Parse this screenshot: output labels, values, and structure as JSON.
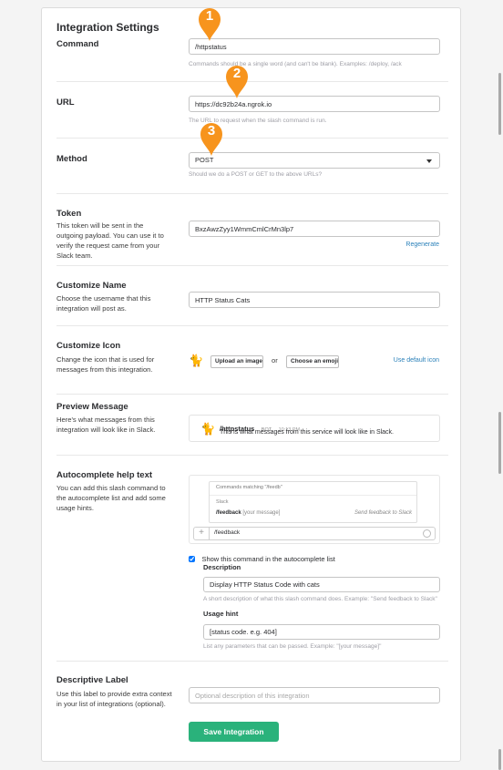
{
  "page": {
    "heading": "Integration Settings",
    "save_label": "Save Integration"
  },
  "markers": [
    "1",
    "2",
    "3"
  ],
  "command": {
    "label": "Command",
    "value": "/httpstatus",
    "hint": "Commands should be a single word (and can't be blank). Examples: /deploy, /ack"
  },
  "url": {
    "label": "URL",
    "value": "https://dc92b24a.ngrok.io",
    "hint": "The URL to request when the slash command is run."
  },
  "method": {
    "label": "Method",
    "value": "POST",
    "hint": "Should we do a POST or GET to the above URLs?"
  },
  "token": {
    "label": "Token",
    "desc": "This token will be sent in the outgoing payload. You can use it to verify the request came from your Slack team.",
    "value": "BxzAwzZyy1WmmCmlCrMn3lp7",
    "regenerate": "Regenerate"
  },
  "customize_name": {
    "label": "Customize Name",
    "desc": "Choose the username that this integration will post as.",
    "value": "HTTP Status Cats"
  },
  "customize_icon": {
    "label": "Customize Icon",
    "desc": "Change the icon that is used for messages from this integration.",
    "upload": "Upload an image",
    "or": "or",
    "emoji": "Choose an emoji",
    "default": "Use default icon"
  },
  "preview": {
    "label": "Preview Message",
    "desc": "Here's what messages from this integration will look like in Slack.",
    "name": "/httpstatus",
    "badge": "BOT",
    "time": "10:13 PM",
    "text": "This is what messages from this service will look like in Slack."
  },
  "autocomplete": {
    "label": "Autocomplete help text",
    "desc": "You can add this slash command to the autocomplete list and add some usage hints.",
    "matching": "Commands matching \"/feedb\"",
    "section": "Slack",
    "cmd": "/feedback",
    "usage_example": "[your message]",
    "cmd_desc": "Send feedback to Slack",
    "input_value": "/feedback",
    "plus": "+",
    "checkbox_label": "Show this command in the autocomplete list",
    "checked": true,
    "description_label": "Description",
    "description_value": "Display HTTP Status Code with cats",
    "description_hint": "A short description of what this slash command does. Example: \"Send feedback to Slack\"",
    "usage_label": "Usage hint",
    "usage_value": "[status code. e.g. 404]",
    "usage_hint": "List any parameters that can be passed. Example: \"[your message]\""
  },
  "descriptive_label": {
    "label": "Descriptive Label",
    "desc": "Use this label to provide extra context in your list of integrations (optional).",
    "placeholder": "Optional description of this integration"
  },
  "icons": {
    "avatar": "cat-icon",
    "dropdown": "caret-down-icon",
    "emoji": "smiley-icon"
  },
  "colors": {
    "accent_green": "#2ab27b",
    "marker_orange": "#f7941d",
    "link_blue": "#2a80b9"
  }
}
